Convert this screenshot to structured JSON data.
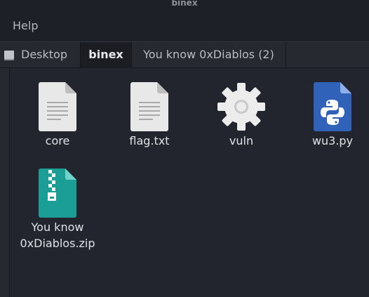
{
  "window": {
    "title": "binex"
  },
  "menu": {
    "items": [
      {
        "label": "Help"
      }
    ]
  },
  "pathbar": {
    "crumbs": [
      {
        "label": "Desktop",
        "icon": "desktop-icon"
      },
      {
        "label": "binex",
        "active": true
      },
      {
        "label": "You know 0xDiablos (2)"
      }
    ]
  },
  "files": [
    {
      "name": "core",
      "icon": "text-document-icon"
    },
    {
      "name": "flag.txt",
      "icon": "text-document-icon"
    },
    {
      "name": "vuln",
      "icon": "executable-gear-icon"
    },
    {
      "name": "wu3.py",
      "icon": "python-file-icon"
    },
    {
      "name_line1": "You know",
      "name_line2": "0xDiablos.zip",
      "icon": "zip-archive-icon"
    }
  ],
  "colors": {
    "background": "#22252e",
    "python_blue": "#2f62b8",
    "zip_teal": "#1a9e96"
  }
}
